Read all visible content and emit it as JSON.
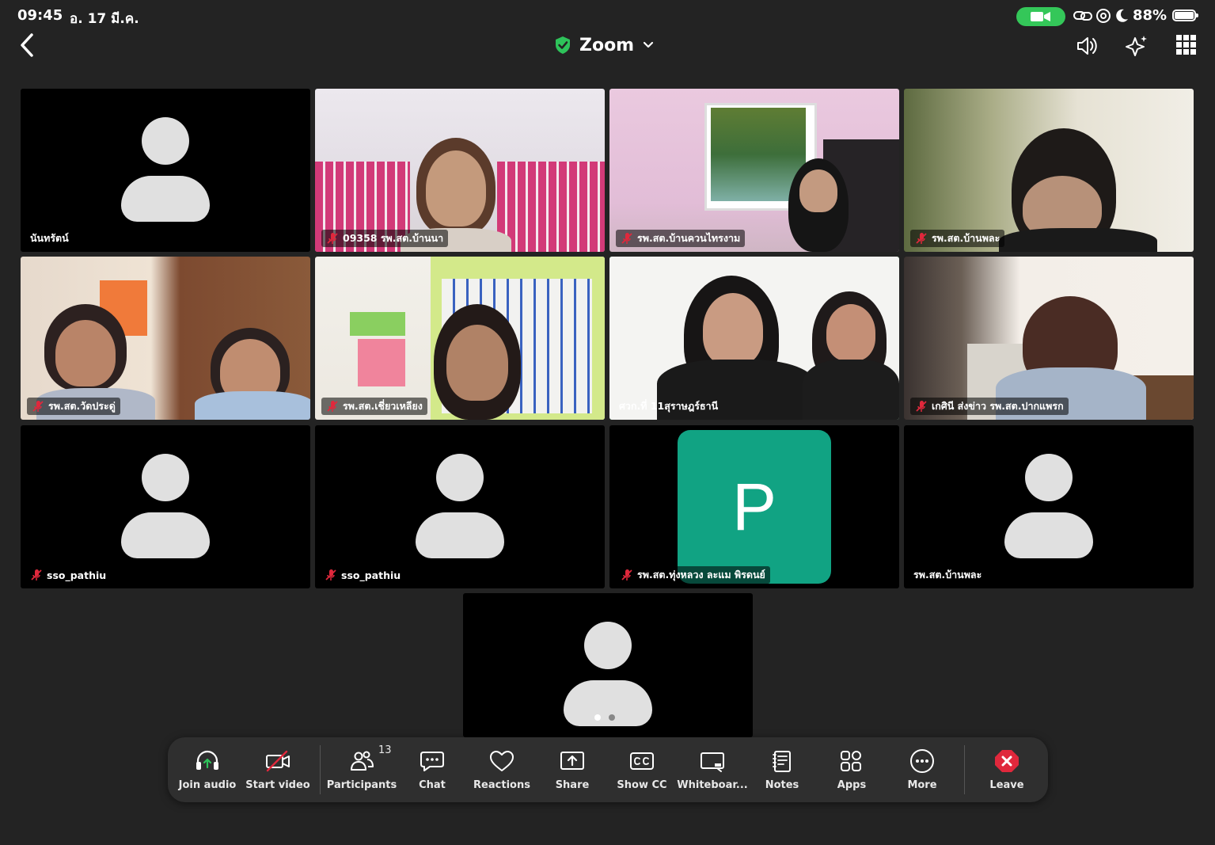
{
  "status_bar": {
    "time": "09:45",
    "date": "อ. 17 มี.ค.",
    "battery_percent": "88%",
    "battery_level": 0.88,
    "icons": [
      "camera-in-use-icon",
      "link-icon",
      "at-icon",
      "moon-icon",
      "battery-icon"
    ]
  },
  "nav": {
    "title": "Zoom",
    "icons": [
      "back-chevron-icon",
      "shield-check-icon",
      "chevron-down-icon",
      "speaker-icon",
      "sparkle-icon",
      "grid-icon"
    ]
  },
  "colors": {
    "background": "#232323",
    "active_speaker_border": "#2ec35a",
    "secure_green": "#2ec35a",
    "mic_muted_red": "#e0283c",
    "leave_red": "#e0283c",
    "p_avatar": "#11a383"
  },
  "participants": [
    {
      "name": "นันทรัตน์",
      "muted": false,
      "video": false
    },
    {
      "name": "09358 รพ.สต.บ้านนา",
      "muted": true,
      "video": true
    },
    {
      "name": "รพ.สต.บ้านควนไทรงาม",
      "muted": true,
      "video": true
    },
    {
      "name": "รพ.สต.บ้านพละ",
      "muted": true,
      "video": true
    },
    {
      "name": "รพ.สต.วัดประดู่",
      "muted": true,
      "video": true
    },
    {
      "name": "รพ.สต.เชี่ยวเหลียง",
      "muted": true,
      "video": true
    },
    {
      "name": "ศวก.ที่ 11สุราษฎร์ธานี",
      "muted": false,
      "video": true,
      "active": true
    },
    {
      "name": "เกศินี ส่งข่าว รพ.สต.ปากแพรก",
      "muted": true,
      "video": true
    },
    {
      "name": "sso_pathiu",
      "muted": true,
      "video": false
    },
    {
      "name": "sso_pathiu",
      "muted": true,
      "video": false
    },
    {
      "name": "รพ.สต.ทุ่งหลวง ละแม พิรดนย์",
      "muted": true,
      "video": false,
      "avatar_letter": "P"
    },
    {
      "name": "รพ.สต.บ้านพละ",
      "muted": false,
      "video": false
    },
    {
      "name": "",
      "muted": false,
      "video": false
    }
  ],
  "pagination": {
    "pages": 2,
    "current": 1
  },
  "toolbar": {
    "join_audio": "Join audio",
    "start_video": "Start video",
    "participants": "Participants",
    "participants_count": "13",
    "chat": "Chat",
    "reactions": "Reactions",
    "share": "Share",
    "show_cc": "Show CC",
    "whiteboard": "Whiteboar...",
    "notes": "Notes",
    "apps": "Apps",
    "more": "More",
    "leave": "Leave"
  }
}
